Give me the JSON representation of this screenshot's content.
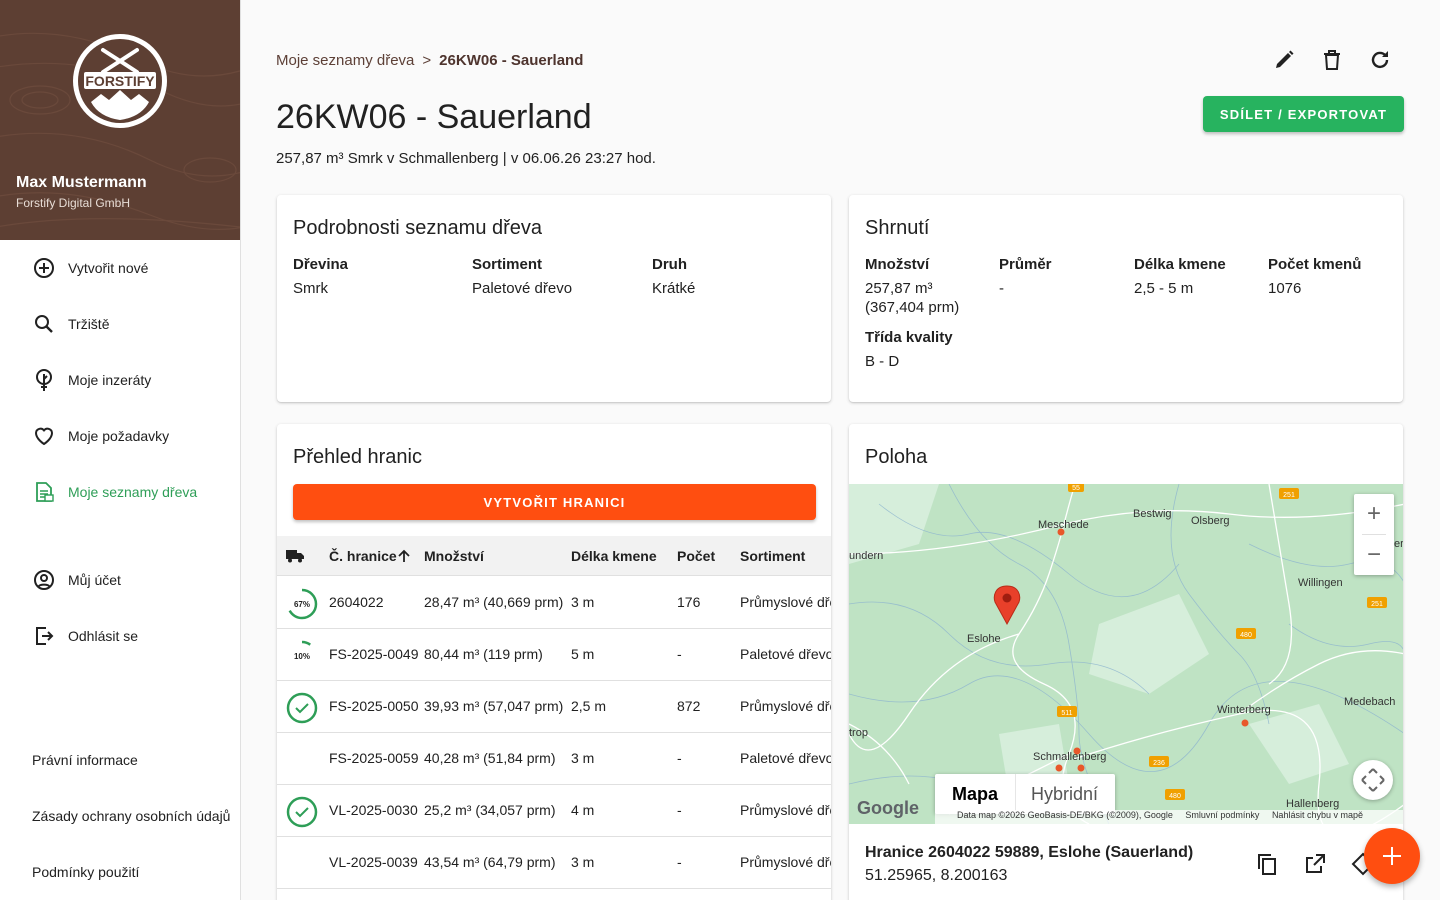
{
  "sidebar": {
    "logo_text": "FORSTIFY",
    "user_name": "Max Mustermann",
    "company": "Forstify Digital GmbH",
    "nav": [
      {
        "label": "Vytvořit nové",
        "icon": "plus-circle-icon"
      },
      {
        "label": "Tržiště",
        "icon": "search-icon"
      },
      {
        "label": "Moje inzeráty",
        "icon": "tree-icon"
      },
      {
        "label": "Moje požadavky",
        "icon": "heart-icon"
      },
      {
        "label": "Moje seznamy dřeva",
        "icon": "document-list-icon",
        "active": true
      },
      {
        "label": "Můj účet",
        "icon": "account-circle-icon"
      },
      {
        "label": "Odhlásit se",
        "icon": "logout-icon"
      }
    ],
    "footer": [
      "Právní informace",
      "Zásady ochrany osobních údajů",
      "Podmínky použití"
    ],
    "active_color": "#2e9e57"
  },
  "header": {
    "breadcrumb_parent": "Moje seznamy dřeva",
    "breadcrumb_sep": ">",
    "breadcrumb_current": "26KW06 - Sauerland",
    "title": "26KW06 - Sauerland",
    "subtitle": "257,87 m³ Smrk v Schmallenberg | v 06.06.26 23:27 hod.",
    "share_label": "SDÍLET / EXPORTOVAT",
    "actions": [
      "pencil-icon",
      "trash-icon",
      "refresh-icon"
    ]
  },
  "details": {
    "title": "Podrobnosti seznamu dřeva",
    "fields": [
      {
        "label": "Dřevina",
        "value": "Smrk"
      },
      {
        "label": "Sortiment",
        "value": "Paletové dřevo"
      },
      {
        "label": "Druh",
        "value": "Krátké"
      }
    ]
  },
  "summary": {
    "title": "Shrnutí",
    "quantity_label": "Množství",
    "quantity_value_1": "257,87 m³",
    "quantity_value_2": "(367,404 prm)",
    "diameter_label": "Průměr",
    "diameter_value": "-",
    "length_label": "Délka kmene",
    "length_value": "2,5 - 5 m",
    "count_label": "Počet kmenů",
    "count_value": "1076",
    "quality_label": "Třída kvality",
    "quality_value": "B - D"
  },
  "piles": {
    "title": "Přehled hranic",
    "create_label": "VYTVOŘIT HRANICI",
    "columns": [
      "Č. hranice",
      "Množství",
      "Délka kmene",
      "Počet",
      "Sortiment"
    ],
    "rows": [
      {
        "status": "67%",
        "progress": 0.67,
        "id": "2604022",
        "qty": "28,47 m³ (40,669 prm)",
        "len": "3 m",
        "count": "176",
        "assort": "Průmyslové dřevo"
      },
      {
        "status": "10%",
        "progress": 0.1,
        "id": "FS-2025-0049",
        "qty": "80,44 m³ (119 prm)",
        "len": "5 m",
        "count": "-",
        "assort": "Paletové dřevo"
      },
      {
        "status": "done",
        "progress": 1,
        "id": "FS-2025-0050",
        "qty": "39,93 m³ (57,047 prm)",
        "len": "2,5 m",
        "count": "872",
        "assort": "Průmyslové dřevo"
      },
      {
        "status": "",
        "progress": 0,
        "id": "FS-2025-0059",
        "qty": "40,28 m³ (51,84 prm)",
        "len": "3 m",
        "count": "-",
        "assort": "Paletové dřevo"
      },
      {
        "status": "done",
        "progress": 1,
        "id": "VL-2025-0030",
        "qty": "25,2 m³ (34,057 prm)",
        "len": "4 m",
        "count": "-",
        "assort": "Průmyslové dřevo"
      },
      {
        "status": "",
        "progress": 0,
        "id": "VL-2025-0039",
        "qty": "43,54 m³ (64,79 prm)",
        "len": "3 m",
        "count": "-",
        "assort": "Průmyslové dřevo"
      }
    ]
  },
  "location": {
    "title": "Poloha",
    "map_type_map": "Mapa",
    "map_type_hybrid": "Hybridní",
    "google": "Google",
    "attribution": "Data map ©2026 GeoBasis-DE/BKG (©2009), Google",
    "terms": "Smluvní podmínky",
    "report": "Nahlásit chybu v mapě",
    "places": [
      "Meschede",
      "Bestwig",
      "Olsberg",
      "Willingen",
      "Eslohe",
      "Winterberg",
      "Medebach",
      "Schmallenberg",
      "Hallenberg",
      "undern",
      "trop",
      "er"
    ],
    "roads": [
      "55",
      "251",
      "251",
      "480",
      "511",
      "236",
      "480"
    ],
    "name": "Hranice 2604022 59889, Eslohe (Sauerland)",
    "coords": "51.25965, 8.200163"
  },
  "colors": {
    "brand_brown": "#5d3f33",
    "green": "#27b35f",
    "orange": "#ff4e10"
  }
}
